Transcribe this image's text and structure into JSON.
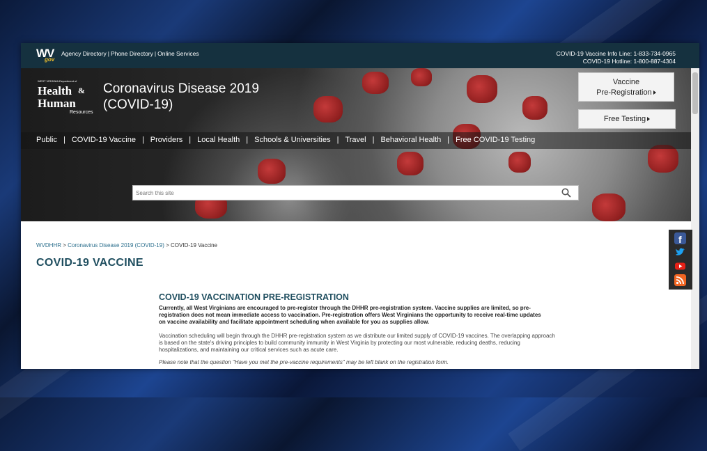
{
  "topbar": {
    "logo": {
      "main": "WV",
      "sub": "gov"
    },
    "links": [
      "Agency Directory",
      "Phone Directory",
      "Online Services"
    ],
    "hotlines": [
      "COVID-19 Vaccine Info Line: 1-833-734-0965",
      "COVID-19 Hotline: 1-800-887-4304"
    ]
  },
  "hero": {
    "dept_logo": {
      "small": "WEST VIRGINIA Department of",
      "line1": "Health",
      "line2": "Human",
      "line3": "Resources",
      "amp": "&"
    },
    "title_line1": "Coronavirus Disease 2019",
    "title_line2": "(COVID-19)",
    "cta_vaccine": {
      "line1": "Vaccine",
      "line2": "Pre-Registration"
    },
    "cta_testing": "Free Testing"
  },
  "nav": {
    "items": [
      "Public",
      "COVID-19 Vaccine",
      "Providers",
      "Local Health",
      "Schools & Universities",
      "Travel",
      "Behavioral Health",
      "Free COVID-19 Testing"
    ],
    "separator": "|"
  },
  "search": {
    "placeholder": "Search this site"
  },
  "social": [
    "facebook-icon",
    "twitter-icon",
    "youtube-icon",
    "rss-icon"
  ],
  "colors": {
    "topbar": "#15313f",
    "heading": "#1f4e5f",
    "link": "#2a6e8c",
    "facebook": "#3b5998",
    "twitter": "#1da1f2",
    "youtube": "#e62117",
    "rss": "#f26522"
  },
  "breadcrumb": {
    "items": [
      "WVDHHR",
      "Coronavirus Disease 2019 (COVID-19)",
      "COVID-19 Vaccine"
    ],
    "separator": ">"
  },
  "page": {
    "title": "COVID-19 VACCINE",
    "section_title": "COVID-19 VACCINATION PRE-REGISTRATION",
    "intro": "Currently, all West Virginians are encouraged to pre-register through the DHHR pre-registration system. Vaccine supplies are limited, so pre-registration does not mean immediate access to vaccination. Pre-registration offers West Virginians the opportunity to receive real-time updates on vaccine availability and facilitate appointment scheduling when available for you as supplies allow.",
    "body": "Vaccination scheduling will begin through the DHHR pre-registration system as we distribute our limited supply of COVID-19 vaccines. The overlapping approach is based on the state's driving principles to build community immunity in West Virginia by protecting our most vulnerable, reducing deaths, reducing hospitalizations, and maintaining our critical services such as acute care.",
    "note": "Please note that the question \"Have you met the pre-vaccine requirements\" may be left blank on the registration form."
  }
}
